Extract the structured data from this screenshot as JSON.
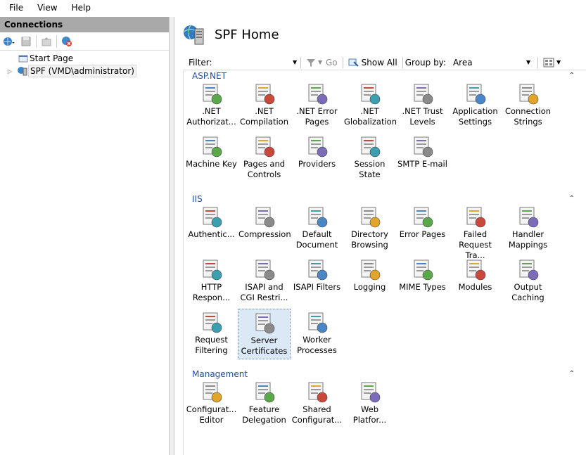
{
  "menu": [
    "File",
    "View",
    "Help"
  ],
  "connections": {
    "title": "Connections",
    "tree": [
      {
        "label": "Start Page"
      },
      {
        "label": "SPF (VMD\\administrator)"
      }
    ]
  },
  "page": {
    "title": "SPF Home"
  },
  "filterbar": {
    "filter_label": "Filter:",
    "filter_value": "",
    "go_label": "Go",
    "show_all_label": "Show All",
    "group_by_label": "Group by:",
    "group_by_value": "Area"
  },
  "groups": [
    {
      "name": "ASP.NET",
      "items": [
        {
          "label": ".NET\nAuthorizat...",
          "icon": "net-authorization-icon"
        },
        {
          "label": ".NET\nCompilation",
          "icon": "net-compilation-icon"
        },
        {
          "label": ".NET Error\nPages",
          "icon": "net-error-pages-icon"
        },
        {
          "label": ".NET\nGlobalization",
          "icon": "net-globalization-icon"
        },
        {
          "label": ".NET Trust\nLevels",
          "icon": "net-trust-levels-icon"
        },
        {
          "label": "Application\nSettings",
          "icon": "application-settings-icon"
        },
        {
          "label": "Connection\nStrings",
          "icon": "connection-strings-icon"
        },
        {
          "label": "Machine Key",
          "icon": "machine-key-icon"
        },
        {
          "label": "Pages and\nControls",
          "icon": "pages-controls-icon"
        },
        {
          "label": "Providers",
          "icon": "providers-icon"
        },
        {
          "label": "Session State",
          "icon": "session-state-icon"
        },
        {
          "label": "SMTP E-mail",
          "icon": "smtp-email-icon"
        }
      ]
    },
    {
      "name": "IIS",
      "items": [
        {
          "label": "Authentic...",
          "icon": "authentication-icon"
        },
        {
          "label": "Compression",
          "icon": "compression-icon"
        },
        {
          "label": "Default\nDocument",
          "icon": "default-document-icon"
        },
        {
          "label": "Directory\nBrowsing",
          "icon": "directory-browsing-icon"
        },
        {
          "label": "Error Pages",
          "icon": "error-pages-icon"
        },
        {
          "label": "Failed\nRequest Tra...",
          "icon": "failed-request-icon"
        },
        {
          "label": "Handler\nMappings",
          "icon": "handler-mappings-icon"
        },
        {
          "label": "HTTP\nRespon...",
          "icon": "http-response-icon"
        },
        {
          "label": "ISAPI and\nCGI Restri...",
          "icon": "isapi-cgi-icon"
        },
        {
          "label": "ISAPI Filters",
          "icon": "isapi-filters-icon"
        },
        {
          "label": "Logging",
          "icon": "logging-icon"
        },
        {
          "label": "MIME Types",
          "icon": "mime-types-icon"
        },
        {
          "label": "Modules",
          "icon": "modules-icon"
        },
        {
          "label": "Output\nCaching",
          "icon": "output-caching-icon"
        },
        {
          "label": "Request\nFiltering",
          "icon": "request-filtering-icon"
        },
        {
          "label": "Server\nCertificates",
          "icon": "server-certificates-icon"
        },
        {
          "label": "Worker\nProcesses",
          "icon": "worker-processes-icon"
        }
      ]
    },
    {
      "name": "Management",
      "items": [
        {
          "label": "Configurat...\nEditor",
          "icon": "configuration-editor-icon"
        },
        {
          "label": "Feature\nDelegation",
          "icon": "feature-delegation-icon"
        },
        {
          "label": "Shared\nConfigurat...",
          "icon": "shared-configuration-icon"
        },
        {
          "label": "Web\nPlatfor...",
          "icon": "web-platform-icon"
        }
      ]
    }
  ]
}
